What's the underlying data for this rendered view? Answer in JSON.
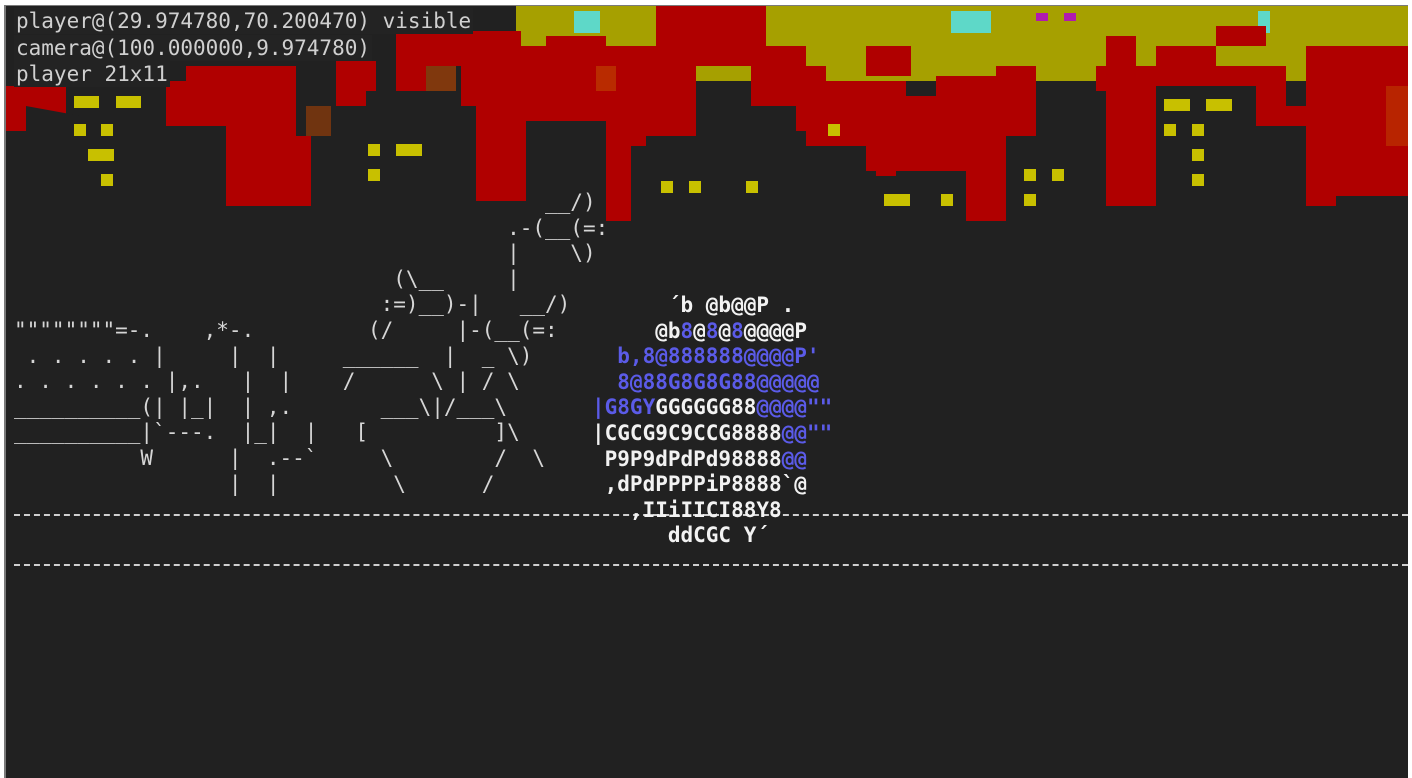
{
  "hud": {
    "player_position": "player@(29.974780,70.200470) visible",
    "camera_position": "camera@(100.000000,9.974780)",
    "player_size": "player 21x11"
  },
  "colors": {
    "background": "#212121",
    "sky": "#a6a000",
    "fire": "#b00000",
    "window": "#c8c000",
    "teal": "#5ed8c8",
    "magenta": "#b01ab0",
    "text": "#d0d0d0",
    "player_blue": "#5b5be8"
  },
  "scene": {
    "background_ascii": [
      "                                          __/)",
      "                                       .-(__(=:",
      "                                       |    \\)",
      "                              (\\__     |",
      "                             :=)__)-|   __/)",
      "\"\"\"\"\"\"\"\"=-.    ,*-.         (/     |-(__(=:",
      " . . . . . |     |  |     ______  |  _ \\)",
      ". . . . . . |,.   |  |    /      \\ | / \\",
      "__________(| |_|  | ,.       ___\\|/___\\",
      "__________|`---.  |_|  |   [          ]\\",
      "          W      |  .--`     \\        /  \\",
      "                 |  |         \\      /"
    ]
  },
  "player_sprite": [
    [
      {
        "t": "      ´b @b@@P .",
        "c": "w"
      }
    ],
    [
      {
        "t": "     @b",
        "c": "w"
      },
      {
        "t": "8",
        "c": "b"
      },
      {
        "t": "@",
        "c": "w"
      },
      {
        "t": "8",
        "c": "b"
      },
      {
        "t": "@",
        "c": "w"
      },
      {
        "t": "8",
        "c": "b"
      },
      {
        "t": "@@@@P",
        "c": "w"
      }
    ],
    [
      {
        "t": "  b,8@888888@@@@P'",
        "c": "b"
      }
    ],
    [
      {
        "t": "  8@88G8G8G88@@@@@",
        "c": "b"
      }
    ],
    [
      {
        "t": "|G8GY",
        "c": "b"
      },
      {
        "t": "GGGGGG88",
        "c": "w"
      },
      {
        "t": "@@@@\"\"",
        "c": "b"
      }
    ],
    [
      {
        "t": "|CGCG9C9CCG8888",
        "c": "w"
      },
      {
        "t": "@@\"\"",
        "c": "b"
      }
    ],
    [
      {
        "t": " P9P9dPdPd98888",
        "c": "w"
      },
      {
        "t": "@@",
        "c": "b"
      }
    ],
    [
      {
        "t": " ,dPdPPPPiP8888`@",
        "c": "w"
      }
    ],
    [
      {
        "t": "   ,IIiIICI88Y8",
        "c": "w"
      }
    ],
    [
      {
        "t": "      ddCGC Y´",
        "c": "w"
      }
    ]
  ]
}
